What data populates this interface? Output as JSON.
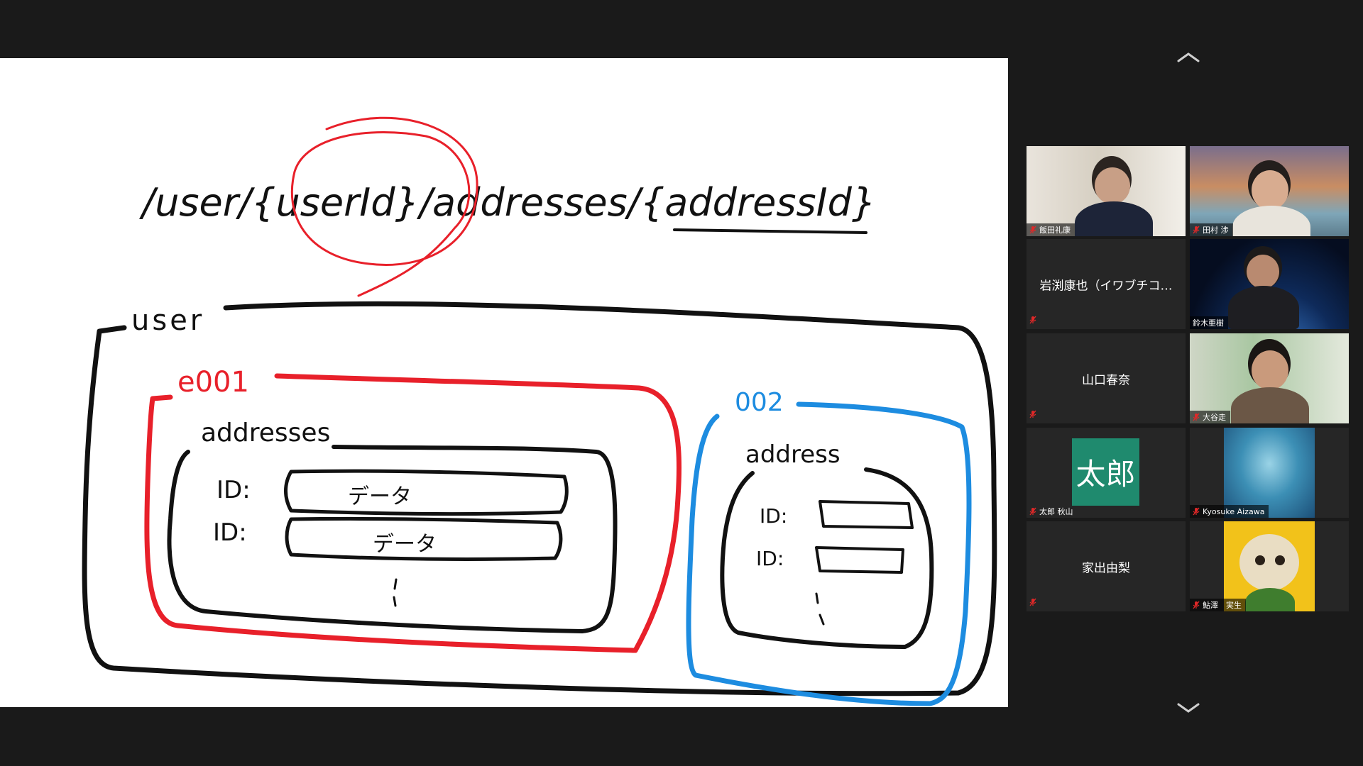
{
  "whiteboard": {
    "url_path": "/user/{userId}/addresses/{addressId}",
    "collection_user": "user",
    "doc_001": "e001",
    "doc_002": "002",
    "sub_addresses": "addresses",
    "sub_address": "address",
    "field_id_1": "ID:",
    "field_id_2": "ID:",
    "data_1": "データ",
    "data_2": "データ",
    "small_id_1": "ID:",
    "small_id_2": "ID:"
  },
  "participants": [
    {
      "name": "飯田礼康",
      "video": true,
      "muted": true
    },
    {
      "name": "田村 渉",
      "video": true,
      "muted": true
    },
    {
      "name": "岩渕康也（イワブチコ…",
      "video": false,
      "muted": true
    },
    {
      "name": "鈴木亜樹",
      "video": true,
      "muted": false,
      "active_speaker": true
    },
    {
      "name": "山口春奈",
      "video": false,
      "muted": true
    },
    {
      "name": "大谷走",
      "video": true,
      "muted": true
    },
    {
      "name": "太郎 秋山",
      "video": false,
      "muted": true,
      "avatar_text": "太郎"
    },
    {
      "name": "Kyosuke Aizawa",
      "video": true,
      "muted": true
    },
    {
      "name": "家出由梨",
      "video": false,
      "muted": true
    },
    {
      "name": "鮎澤　実生",
      "video": true,
      "muted": true
    }
  ],
  "icons": {
    "scroll_up": "chevron-up-icon",
    "scroll_down": "chevron-down-icon",
    "mute": "mic-muted-icon"
  },
  "colors": {
    "active_speaker_border": "#e6e64d",
    "avatar_bg": "#1f8a6e",
    "muted_mic": "#e02828",
    "ink_red": "#e8202a",
    "ink_blue": "#1d8ce0",
    "ink_black": "#111111"
  }
}
